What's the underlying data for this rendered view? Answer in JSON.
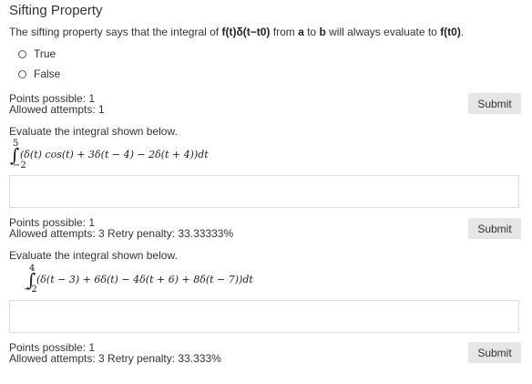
{
  "title": "Sifting Property",
  "statement": {
    "pre": "The sifting property says that the integral of ",
    "expr": "f(t)δ(t−t0)",
    "mid": " from ",
    "a": "a",
    "to": " to ",
    "b": "b",
    "post": " will always evaluate to ",
    "result": "f(t0)",
    "end": "."
  },
  "options": [
    "True",
    "False"
  ],
  "q1_meta": {
    "points": "Points possible: 1",
    "attempts": "Allowed attempts: 1"
  },
  "submit_label": "Submit",
  "q2": {
    "prompt": "Evaluate the integral shown below.",
    "upper": "5",
    "lower": "−2",
    "integrand": "(δ(t) cos(t) + 3δ(t − 4) − 2δ(t + 4))dt",
    "points": "Points possible: 1",
    "attempts": "Allowed attempts: 3  Retry penalty: 33.33333%"
  },
  "q3": {
    "prompt": "Evaluate the integral shown below.",
    "upper": "4",
    "lower": "−2",
    "integrand": "(δ(t − 3) + 6δ(t) − 4δ(t + 6) + 8δ(t − 7))dt",
    "points": "Points possible: 1",
    "attempts": "Allowed attempts: 3  Retry penalty: 33.333%"
  }
}
